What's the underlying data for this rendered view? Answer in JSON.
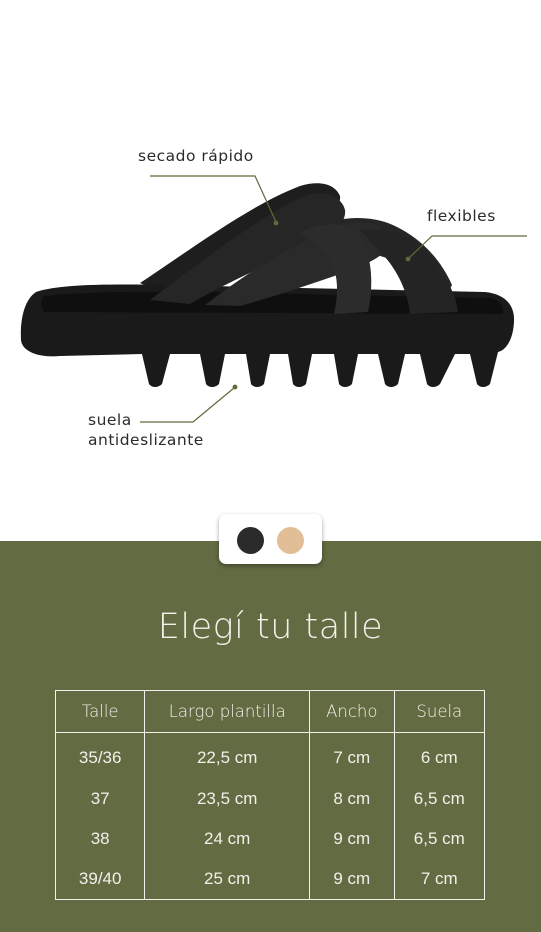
{
  "colors": {
    "panel": "#636b42",
    "callout_line": "#5f6b3a",
    "text_light": "#f2f0ea"
  },
  "callouts": {
    "quick_dry": "secado rápido",
    "flexible": "flexibles",
    "sole_line1": "suela",
    "sole_line2": "antideslizante"
  },
  "swatches": [
    {
      "name": "black",
      "color": "#2b2b2b"
    },
    {
      "name": "beige",
      "color": "#e1be95"
    }
  ],
  "title": "Elegí tu talle",
  "size_table": {
    "headers": [
      "Talle",
      "Largo plantilla",
      "Ancho",
      "Suela"
    ],
    "rows": [
      [
        "35/36",
        "22,5 cm",
        "7 cm",
        "6 cm"
      ],
      [
        "37",
        "23,5 cm",
        "8 cm",
        "6,5 cm"
      ],
      [
        "38",
        "24 cm",
        "9 cm",
        "6,5 cm"
      ],
      [
        "39/40",
        "25 cm",
        "9 cm",
        "7 cm"
      ]
    ]
  }
}
